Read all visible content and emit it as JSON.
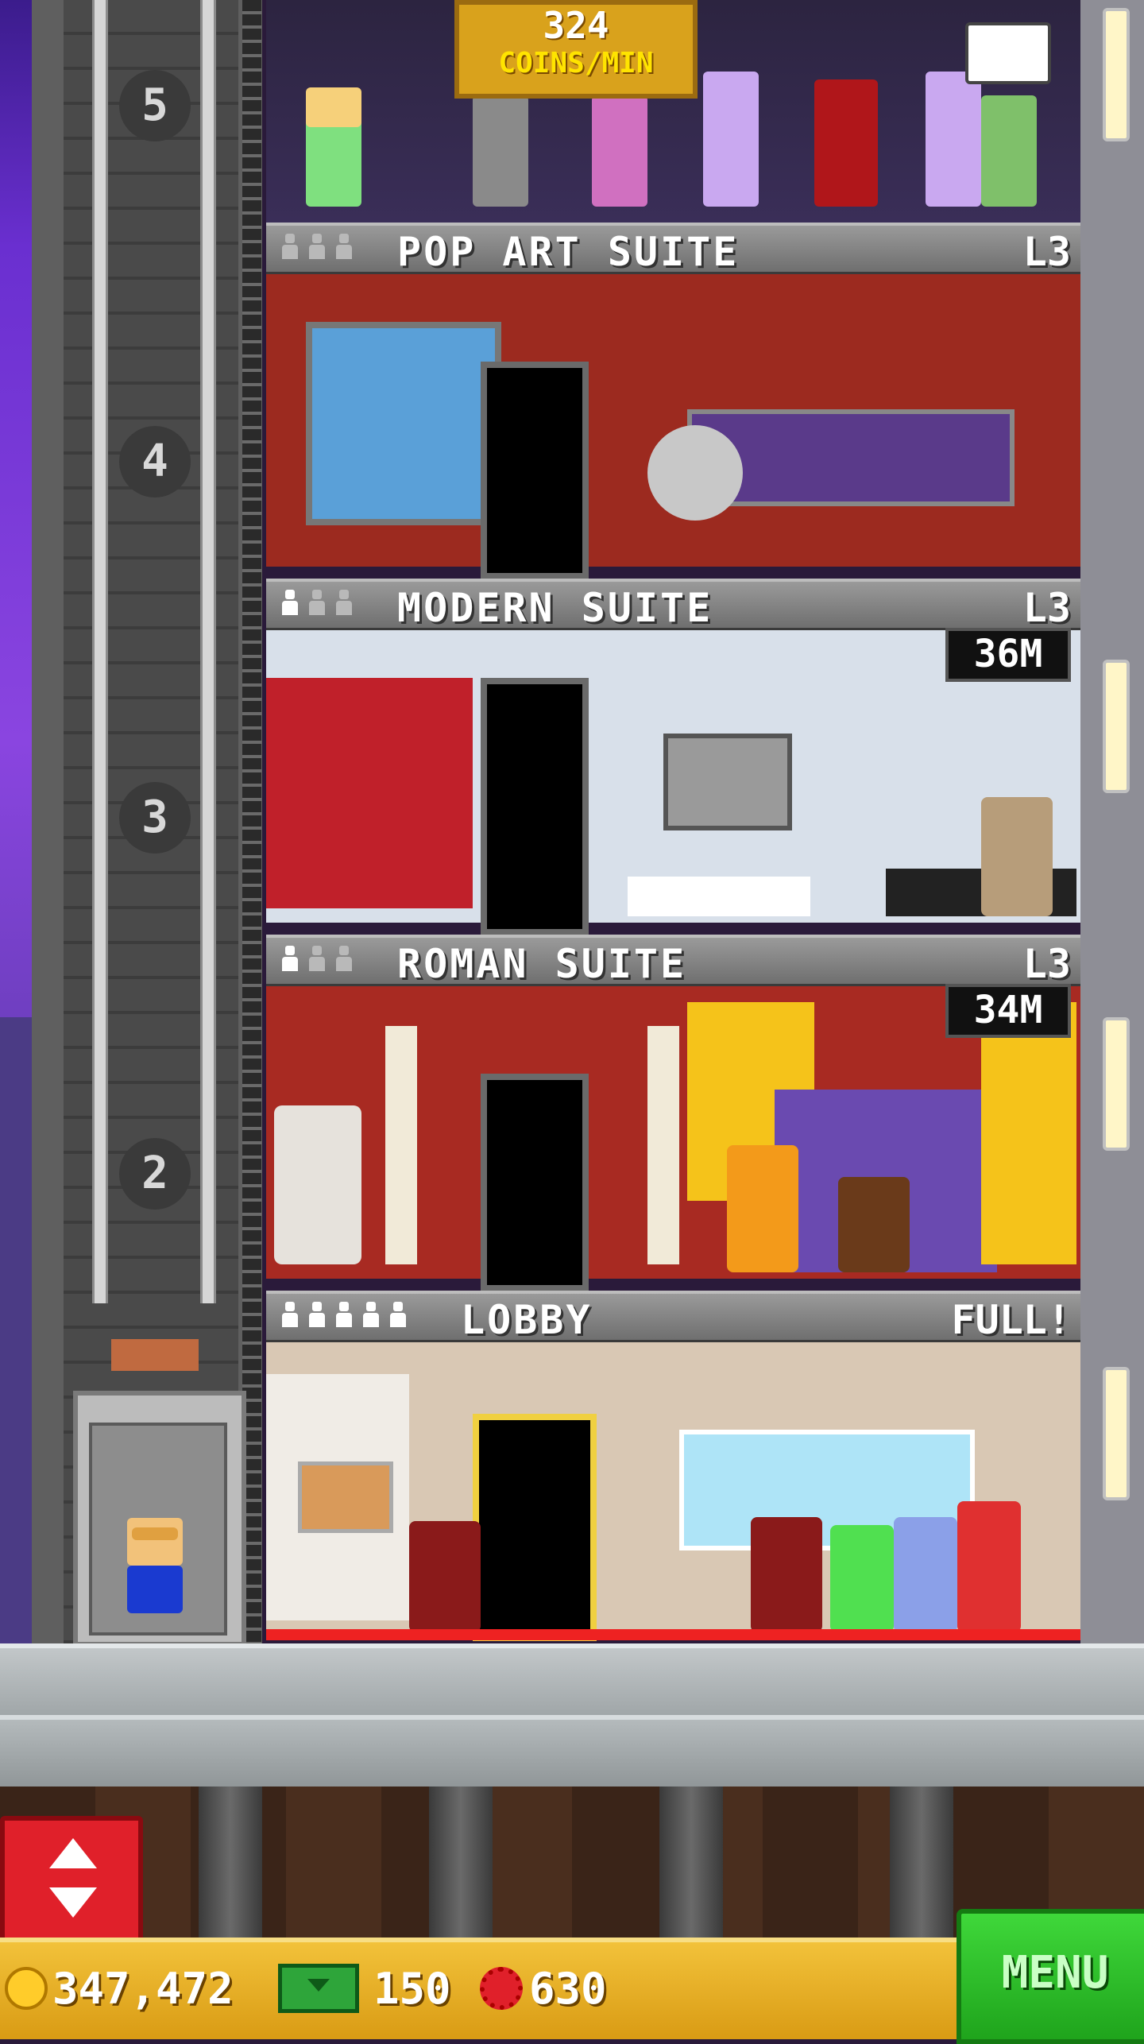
{
  "tower": {
    "coins_per_min": {
      "value": "324",
      "unit": "COINS/MIN"
    },
    "shaft_floor_numbers": [
      "5",
      "4",
      "3",
      "2"
    ],
    "floors": [
      {
        "name": "POP ART SUITE",
        "level": "L3",
        "occupants_filled": 0,
        "occupants_total": 3
      },
      {
        "name": "MODERN SUITE",
        "level": "L3",
        "occupants_filled": 1,
        "occupants_total": 3,
        "price": "36M"
      },
      {
        "name": "ROMAN SUITE",
        "level": "L3",
        "occupants_filled": 1,
        "occupants_total": 3,
        "price": "34M"
      },
      {
        "name": "LOBBY",
        "level": "FULL!",
        "occupants_filled": 5,
        "occupants_total": 5
      }
    ]
  },
  "controls": {
    "elevator_button_icon": "up-down-arrows-icon",
    "menu_label": "MENU"
  },
  "currency": {
    "coins": "347,472",
    "tower_bux": "150",
    "gems": "630",
    "coin_icon": "coin-icon",
    "bux_icon": "bux-icon",
    "gem_icon": "gear-gem-icon"
  },
  "colors": {
    "menu_green": "#2fc62a",
    "elevator_red": "#e0202a",
    "bar_gold": "#e8ae24"
  }
}
